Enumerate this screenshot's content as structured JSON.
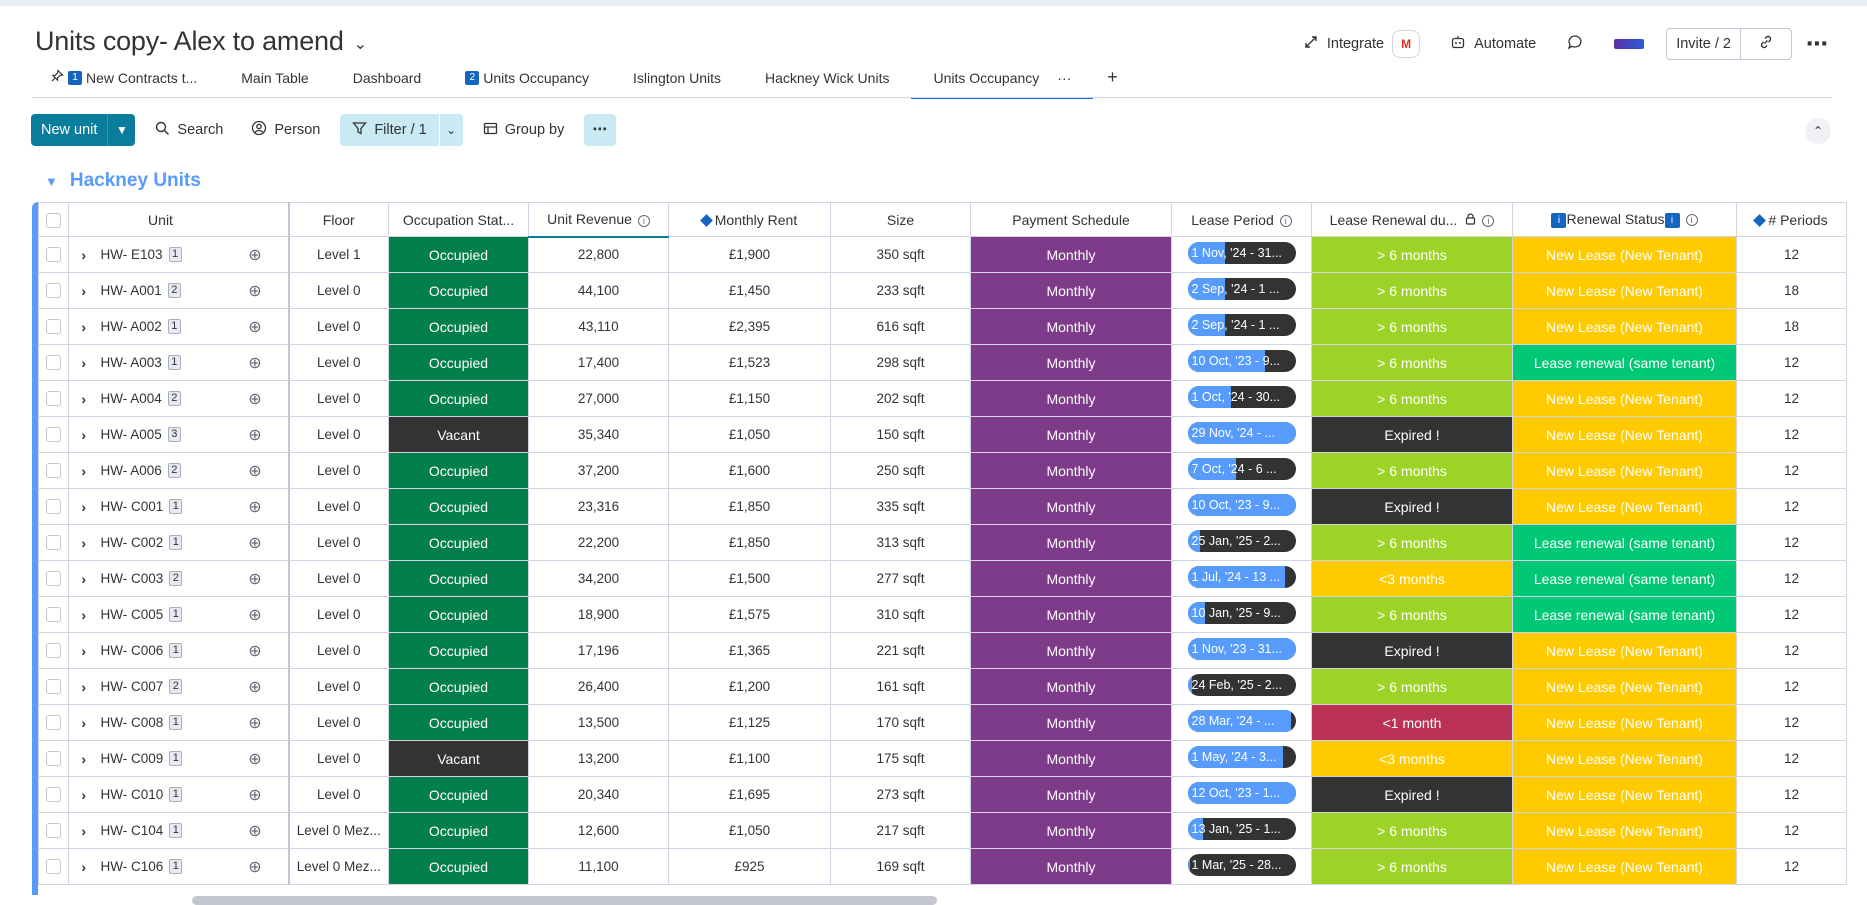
{
  "board": {
    "title": "Units copy- Alex to amend"
  },
  "header_actions": {
    "integrate": "Integrate",
    "gmail_letter": "M",
    "automate": "Automate",
    "invite": "Invite / 2"
  },
  "tabs": [
    {
      "label": "New Contracts t...",
      "badge": "1"
    },
    {
      "label": "Main Table",
      "badge": ""
    },
    {
      "label": "Dashboard",
      "badge": ""
    },
    {
      "label": "Units Occupancy",
      "badge": "2"
    },
    {
      "label": "Islington Units",
      "badge": ""
    },
    {
      "label": "Hackney Wick Units",
      "badge": ""
    },
    {
      "label": "Units Occupancy",
      "badge": "",
      "active": true
    }
  ],
  "tab_more": "···",
  "tab_add": "+",
  "toolbar": {
    "new_item": "New unit",
    "search": "Search",
    "person": "Person",
    "filter": "Filter / 1",
    "group_by": "Group by"
  },
  "group": {
    "title": "Hackney Units"
  },
  "columns": {
    "unit": "Unit",
    "floor": "Floor",
    "occupation": "Occupation Stat...",
    "revenue": "Unit Revenue",
    "rent": "Monthly Rent",
    "size": "Size",
    "payment": "Payment Schedule",
    "lease_period": "Lease Period",
    "lease_renewal": "Lease Renewal du...",
    "renewal_status": "Renewal Status",
    "periods": "# Periods"
  },
  "colors": {
    "occupied": "#037f4c",
    "vacant": "#333333",
    "monthly": "#7e3b8a",
    "gt6": "#9cd326",
    "expired": "#333333",
    "lt3": "#ffcb00",
    "lt1": "#bb3354",
    "new_lease": "#ffcb00",
    "renewal": "#00c875",
    "group": "#579bfc",
    "primary": "#0a7c9c"
  },
  "rows": [
    {
      "unit": "HW- E103",
      "updates": "1",
      "floor": "Level 1",
      "occupation": "Occupied",
      "revenue": "22,800",
      "rent": "£1,900",
      "size": "350 sqft",
      "payment": "Monthly",
      "lease": "1 Nov, '24 - 31...",
      "lease_progress": 0.35,
      "renewal_due": "> 6 months",
      "renewal_status": "New Lease (New Tenant)",
      "periods": "12"
    },
    {
      "unit": "HW- A001",
      "updates": "2",
      "floor": "Level 0",
      "occupation": "Occupied",
      "revenue": "44,100",
      "rent": "£1,450",
      "size": "233 sqft",
      "payment": "Monthly",
      "lease": "2 Sep, '24 - 1 ...",
      "lease_progress": 0.35,
      "renewal_due": "> 6 months",
      "renewal_status": "New Lease (New Tenant)",
      "periods": "18"
    },
    {
      "unit": "HW- A002",
      "updates": "1",
      "floor": "Level 0",
      "occupation": "Occupied",
      "revenue": "43,110",
      "rent": "£2,395",
      "size": "616 sqft",
      "payment": "Monthly",
      "lease": "2 Sep, '24 - 1 ...",
      "lease_progress": 0.35,
      "renewal_due": "> 6 months",
      "renewal_status": "New Lease (New Tenant)",
      "periods": "18"
    },
    {
      "unit": "HW- A003",
      "updates": "1",
      "floor": "Level 0",
      "occupation": "Occupied",
      "revenue": "17,400",
      "rent": "£1,523",
      "size": "298 sqft",
      "payment": "Monthly",
      "lease": "10 Oct, '23 - 9...",
      "lease_progress": 0.72,
      "renewal_due": "> 6 months",
      "renewal_status": "Lease renewal (same tenant)",
      "periods": "12"
    },
    {
      "unit": "HW- A004",
      "updates": "2",
      "floor": "Level 0",
      "occupation": "Occupied",
      "revenue": "27,000",
      "rent": "£1,150",
      "size": "202 sqft",
      "payment": "Monthly",
      "lease": "1 Oct, '24 - 30...",
      "lease_progress": 0.4,
      "renewal_due": "> 6 months",
      "renewal_status": "New Lease (New Tenant)",
      "periods": "12"
    },
    {
      "unit": "HW- A005",
      "updates": "3",
      "floor": "Level 0",
      "occupation": "Vacant",
      "revenue": "35,340",
      "rent": "£1,050",
      "size": "150 sqft",
      "payment": "Monthly",
      "lease": "29 Nov, '24 - ...",
      "lease_progress": 1.0,
      "renewal_due": "Expired !",
      "renewal_status": "New Lease (New Tenant)",
      "periods": "12"
    },
    {
      "unit": "HW- A006",
      "updates": "2",
      "floor": "Level 0",
      "occupation": "Occupied",
      "revenue": "37,200",
      "rent": "£1,600",
      "size": "250 sqft",
      "payment": "Monthly",
      "lease": "7 Oct, '24 - 6 ...",
      "lease_progress": 0.45,
      "renewal_due": "> 6 months",
      "renewal_status": "New Lease (New Tenant)",
      "periods": "12"
    },
    {
      "unit": "HW- C001",
      "updates": "1",
      "floor": "Level 0",
      "occupation": "Occupied",
      "revenue": "23,316",
      "rent": "£1,850",
      "size": "335 sqft",
      "payment": "Monthly",
      "lease": "10 Oct, '23 - 9...",
      "lease_progress": 1.0,
      "renewal_due": "Expired !",
      "renewal_status": "New Lease (New Tenant)",
      "periods": "12"
    },
    {
      "unit": "HW- C002",
      "updates": "1",
      "floor": "Level 0",
      "occupation": "Occupied",
      "revenue": "22,200",
      "rent": "£1,850",
      "size": "313 sqft",
      "payment": "Monthly",
      "lease": "25 Jan, '25 - 2...",
      "lease_progress": 0.12,
      "renewal_due": "> 6 months",
      "renewal_status": "Lease renewal (same tenant)",
      "periods": "12"
    },
    {
      "unit": "HW- C003",
      "updates": "2",
      "floor": "Level 0",
      "occupation": "Occupied",
      "revenue": "34,200",
      "rent": "£1,500",
      "size": "277 sqft",
      "payment": "Monthly",
      "lease": "1 Jul, '24 - 13 ...",
      "lease_progress": 0.9,
      "renewal_due": "<3 months",
      "renewal_status": "Lease renewal (same tenant)",
      "periods": "12"
    },
    {
      "unit": "HW- C005",
      "updates": "1",
      "floor": "Level 0",
      "occupation": "Occupied",
      "revenue": "18,900",
      "rent": "£1,575",
      "size": "310 sqft",
      "payment": "Monthly",
      "lease": "10 Jan, '25 - 9...",
      "lease_progress": 0.16,
      "renewal_due": "> 6 months",
      "renewal_status": "Lease renewal (same tenant)",
      "periods": "12"
    },
    {
      "unit": "HW- C006",
      "updates": "1",
      "floor": "Level 0",
      "occupation": "Occupied",
      "revenue": "17,196",
      "rent": "£1,365",
      "size": "221 sqft",
      "payment": "Monthly",
      "lease": "1 Nov, '23 - 31...",
      "lease_progress": 1.0,
      "renewal_due": "Expired !",
      "renewal_status": "New Lease (New Tenant)",
      "periods": "12"
    },
    {
      "unit": "HW- C007",
      "updates": "2",
      "floor": "Level 0",
      "occupation": "Occupied",
      "revenue": "26,400",
      "rent": "£1,200",
      "size": "161 sqft",
      "payment": "Monthly",
      "lease": "24 Feb, '25 - 2...",
      "lease_progress": 0.04,
      "renewal_due": "> 6 months",
      "renewal_status": "New Lease (New Tenant)",
      "periods": "12"
    },
    {
      "unit": "HW- C008",
      "updates": "1",
      "floor": "Level 0",
      "occupation": "Occupied",
      "revenue": "13,500",
      "rent": "£1,125",
      "size": "170 sqft",
      "payment": "Monthly",
      "lease": "28 Mar, '24 - ...",
      "lease_progress": 0.96,
      "renewal_due": "<1 month",
      "renewal_status": "New Lease (New Tenant)",
      "periods": "12"
    },
    {
      "unit": "HW- C009",
      "updates": "1",
      "floor": "Level 0",
      "occupation": "Vacant",
      "revenue": "13,200",
      "rent": "£1,100",
      "size": "175 sqft",
      "payment": "Monthly",
      "lease": "1 May, '24 - 3...",
      "lease_progress": 0.88,
      "renewal_due": "<3 months",
      "renewal_status": "New Lease (New Tenant)",
      "periods": "12"
    },
    {
      "unit": "HW- C010",
      "updates": "1",
      "floor": "Level 0",
      "occupation": "Occupied",
      "revenue": "20,340",
      "rent": "£1,695",
      "size": "273 sqft",
      "payment": "Monthly",
      "lease": "12 Oct, '23 - 1...",
      "lease_progress": 1.0,
      "renewal_due": "Expired !",
      "renewal_status": "New Lease (New Tenant)",
      "periods": "12"
    },
    {
      "unit": "HW- C104",
      "updates": "1",
      "floor": "Level 0 Mez...",
      "occupation": "Occupied",
      "revenue": "12,600",
      "rent": "£1,050",
      "size": "217 sqft",
      "payment": "Monthly",
      "lease": "13 Jan, '25 - 1...",
      "lease_progress": 0.14,
      "renewal_due": "> 6 months",
      "renewal_status": "New Lease (New Tenant)",
      "periods": "12"
    },
    {
      "unit": "HW- C106",
      "updates": "1",
      "floor": "Level 0 Mez...",
      "occupation": "Occupied",
      "revenue": "11,100",
      "rent": "£925",
      "size": "169 sqft",
      "payment": "Monthly",
      "lease": "1 Mar, '25 - 28...",
      "lease_progress": 0.02,
      "renewal_due": "> 6 months",
      "renewal_status": "New Lease (New Tenant)",
      "periods": "12"
    }
  ]
}
